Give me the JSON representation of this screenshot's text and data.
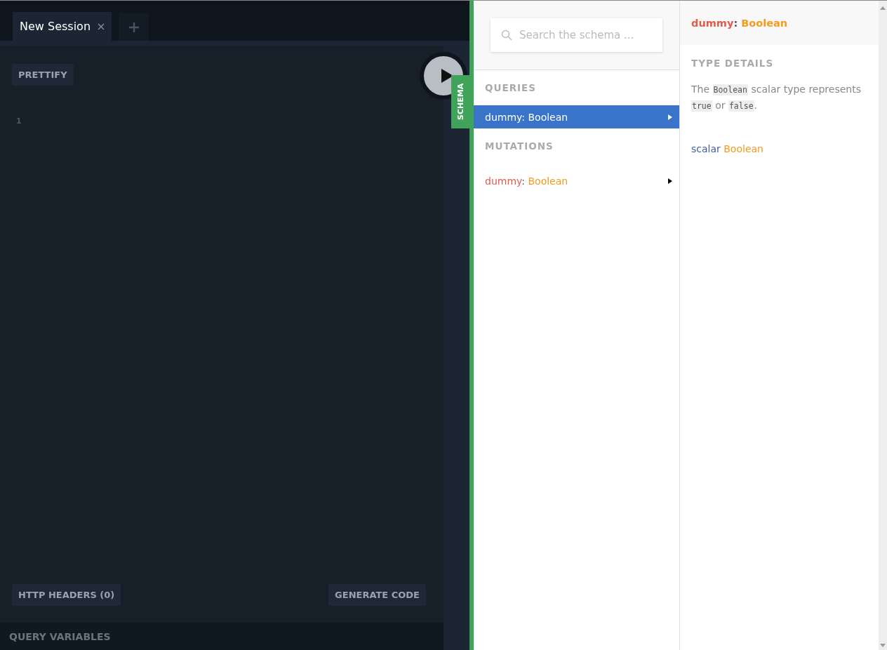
{
  "tabs": [
    {
      "label": "New Session",
      "selected": true
    }
  ],
  "editor": {
    "prettify": "PRETTIFY",
    "line_numbers": [
      "1"
    ],
    "http_headers": "HTTP HEADERS (0)",
    "generate_code": "GENERATE CODE",
    "query_variables": "QUERY VARIABLES"
  },
  "schema_tab": "SCHEMA",
  "search": {
    "placeholder": "Search the schema ..."
  },
  "sections": [
    {
      "heading": "QUERIES",
      "items": [
        {
          "name": "dummy",
          "sep": ":",
          "type": "Boolean",
          "selected": true
        }
      ]
    },
    {
      "heading": "MUTATIONS",
      "items": [
        {
          "name": "dummy",
          "sep": ":",
          "type": "Boolean",
          "selected": false
        }
      ]
    }
  ],
  "detail": {
    "name": "dummy",
    "sep": ":",
    "type": "Boolean",
    "heading": "TYPE DETAILS",
    "description": [
      {
        "kind": "text",
        "text": "The "
      },
      {
        "kind": "code",
        "text": "Boolean"
      },
      {
        "kind": "text",
        "text": " scalar type represents "
      },
      {
        "kind": "code",
        "text": "true"
      },
      {
        "kind": "text",
        "text": " or "
      },
      {
        "kind": "code",
        "text": "false"
      },
      {
        "kind": "text",
        "text": "."
      }
    ],
    "definition": {
      "keyword": "scalar",
      "type": "Boolean"
    }
  }
}
